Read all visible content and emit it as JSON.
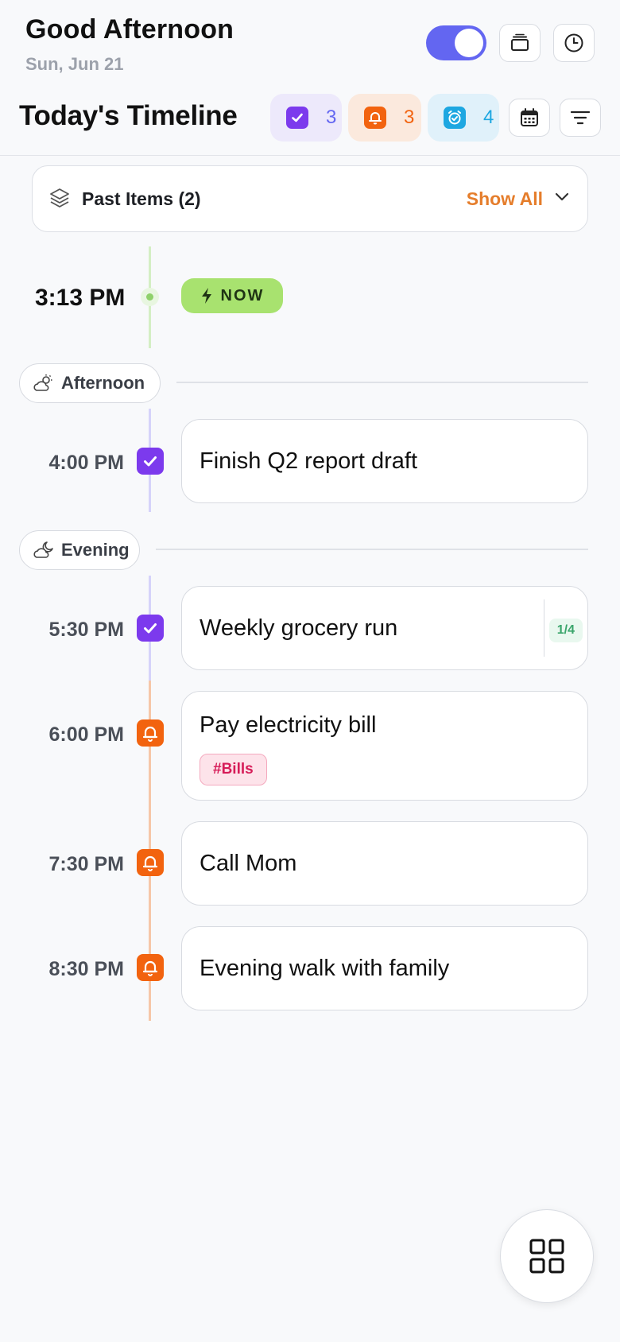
{
  "header": {
    "greeting": "Good Afternoon",
    "date": "Sun, Jun 21",
    "toggle_on": true,
    "title": "Today's Timeline"
  },
  "summary_chips": [
    {
      "name": "tasks",
      "count": "3",
      "icon": "check-icon",
      "color": "#7c3aed",
      "bg": "#ede9fb",
      "text_color": "#6366f1"
    },
    {
      "name": "reminders",
      "count": "3",
      "icon": "bell-icon",
      "color": "#f2630f",
      "bg": "#fbe9dd",
      "text_color": "#f2630f"
    },
    {
      "name": "habits",
      "count": "4",
      "icon": "alarm-check-icon",
      "color": "#1ea7e1",
      "bg": "#e0f1fa",
      "text_color": "#1ea7e1"
    }
  ],
  "past_items": {
    "label": "Past Items (2)",
    "action": "Show All"
  },
  "now": {
    "time": "3:13 PM",
    "badge": "NOW"
  },
  "sections": [
    {
      "label": "Afternoon",
      "icon": "partly-sunny-icon"
    },
    {
      "label": "Evening",
      "icon": "cloudy-moon-icon"
    }
  ],
  "items": [
    {
      "time": "4:00 PM",
      "type": "task",
      "title": "Finish Q2 report draft"
    },
    {
      "time": "5:30 PM",
      "type": "task",
      "title": "Weekly grocery run",
      "progress": "1/4"
    },
    {
      "time": "6:00 PM",
      "type": "reminder",
      "title": "Pay electricity bill",
      "tag": "#Bills"
    },
    {
      "time": "7:30 PM",
      "type": "reminder",
      "title": "Call Mom"
    },
    {
      "time": "8:30 PM",
      "type": "reminder",
      "title": "Evening walk with family"
    }
  ],
  "colors": {
    "accent": "#6366f1",
    "task": "#7c3aed",
    "reminder": "#f2630f",
    "now": "#a8e26f",
    "show_all": "#e57d2b"
  }
}
